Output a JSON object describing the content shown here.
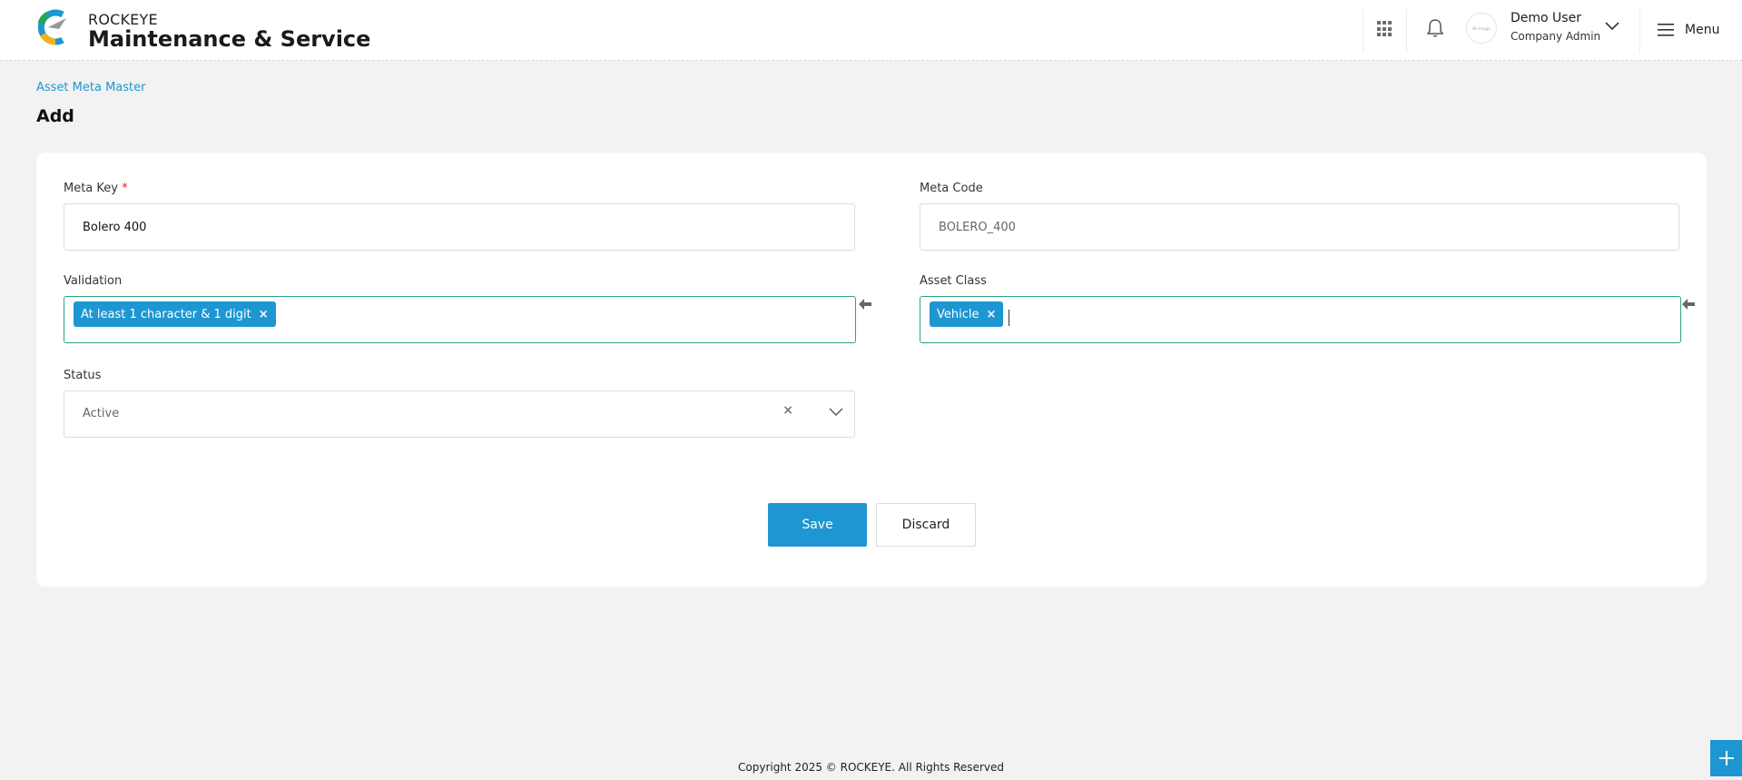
{
  "header": {
    "brand_top": "ROCKEYE",
    "brand_main": "Maintenance & Service",
    "avatar_text": "No Image",
    "user_name": "Demo User",
    "user_role": "Company Admin",
    "menu_label": "Menu"
  },
  "breadcrumb": "Asset Meta Master",
  "page_title": "Add",
  "form": {
    "meta_key": {
      "label": "Meta Key",
      "required_mark": "*",
      "value": "Bolero 400"
    },
    "meta_code": {
      "label": "Meta Code",
      "value": "BOLERO_400"
    },
    "validation": {
      "label": "Validation",
      "tags": [
        "At least 1 character & 1 digit"
      ],
      "remove_glyph": "×"
    },
    "asset_class": {
      "label": "Asset Class",
      "tags": [
        "Vehicle"
      ],
      "remove_glyph": "×"
    },
    "status": {
      "label": "Status",
      "value": "Active",
      "clear_glyph": "×"
    }
  },
  "actions": {
    "save_label": "Save",
    "discard_label": "Discard"
  },
  "footer": "Copyright 2025 © ROCKEYE. All Rights Reserved",
  "colors": {
    "accent": "#1e96d2",
    "tag_border": "#2aa386",
    "required": "#e02424"
  },
  "icons": [
    "logo-icon",
    "apps-grid-icon",
    "bell-icon",
    "chevron-down-icon",
    "hamburger-icon",
    "arrow-left-icon",
    "plus-icon"
  ]
}
